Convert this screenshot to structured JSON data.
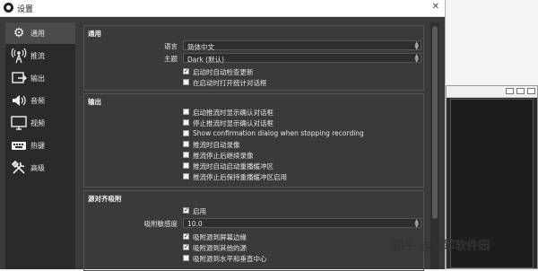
{
  "window": {
    "title": "设置"
  },
  "sidebar": {
    "items": [
      {
        "label": "通用",
        "icon": "gear-icon",
        "selected": true
      },
      {
        "label": "推流",
        "icon": "broadcast-icon",
        "selected": false
      },
      {
        "label": "输出",
        "icon": "output-icon",
        "selected": false
      },
      {
        "label": "音频",
        "icon": "speaker-icon",
        "selected": false
      },
      {
        "label": "视频",
        "icon": "monitor-icon",
        "selected": false
      },
      {
        "label": "热键",
        "icon": "keyboard-icon",
        "selected": false
      },
      {
        "label": "高级",
        "icon": "tools-icon",
        "selected": false
      }
    ]
  },
  "general": {
    "title": "通用",
    "language_label": "语言",
    "language_value": "简体中文",
    "theme_label": "主题",
    "theme_value": "Dark (默认)",
    "checks": [
      {
        "label": "启动时自动检查更新",
        "checked": true
      },
      {
        "label": "在启动时打开统计对话框",
        "checked": false
      }
    ]
  },
  "output": {
    "title": "输出",
    "checks": [
      {
        "label": "启动推流时显示确认对话框",
        "checked": false
      },
      {
        "label": "停止推流时显示确认对话框",
        "checked": false
      },
      {
        "label": "Show confirmation dialog when stopping recording",
        "checked": false
      },
      {
        "label": "推流时自动录像",
        "checked": false
      },
      {
        "label": "推流停止后继续录像",
        "checked": false
      },
      {
        "label": "推流时自动启动重播缓冲区",
        "checked": false
      },
      {
        "label": "推流停止后保持重播缓冲区启用",
        "checked": false
      }
    ]
  },
  "snapping": {
    "title": "源对齐吸附",
    "enable_label": "启用",
    "enable_checked": true,
    "sensitivity_label": "吸附敏感度",
    "sensitivity_value": "10.0",
    "checks": [
      {
        "label": "吸附源到屏幕边缘",
        "checked": true
      },
      {
        "label": "吸附源到其他的源",
        "checked": true
      },
      {
        "label": "吸附源到水平和垂直中心",
        "checked": false
      }
    ]
  },
  "watermark": "知乎 @华军软件园"
}
